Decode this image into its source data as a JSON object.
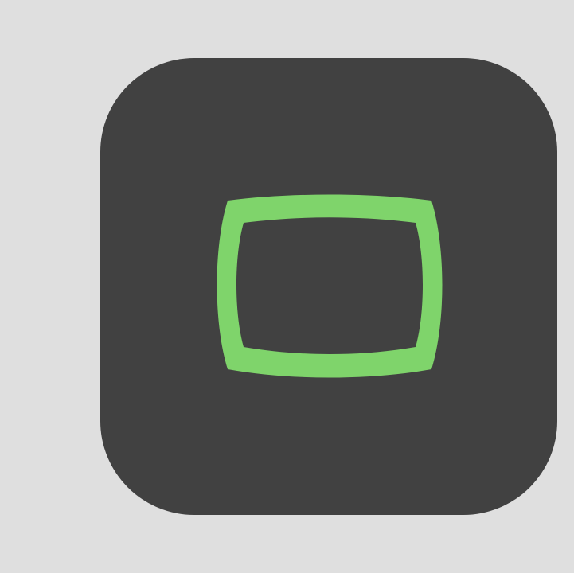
{
  "app_icon": {
    "icon_name": "tv-screen-icon",
    "colors": {
      "page_background": "#dfdfdf",
      "tile_background": "#414141",
      "glyph": "#7fd46b"
    }
  }
}
